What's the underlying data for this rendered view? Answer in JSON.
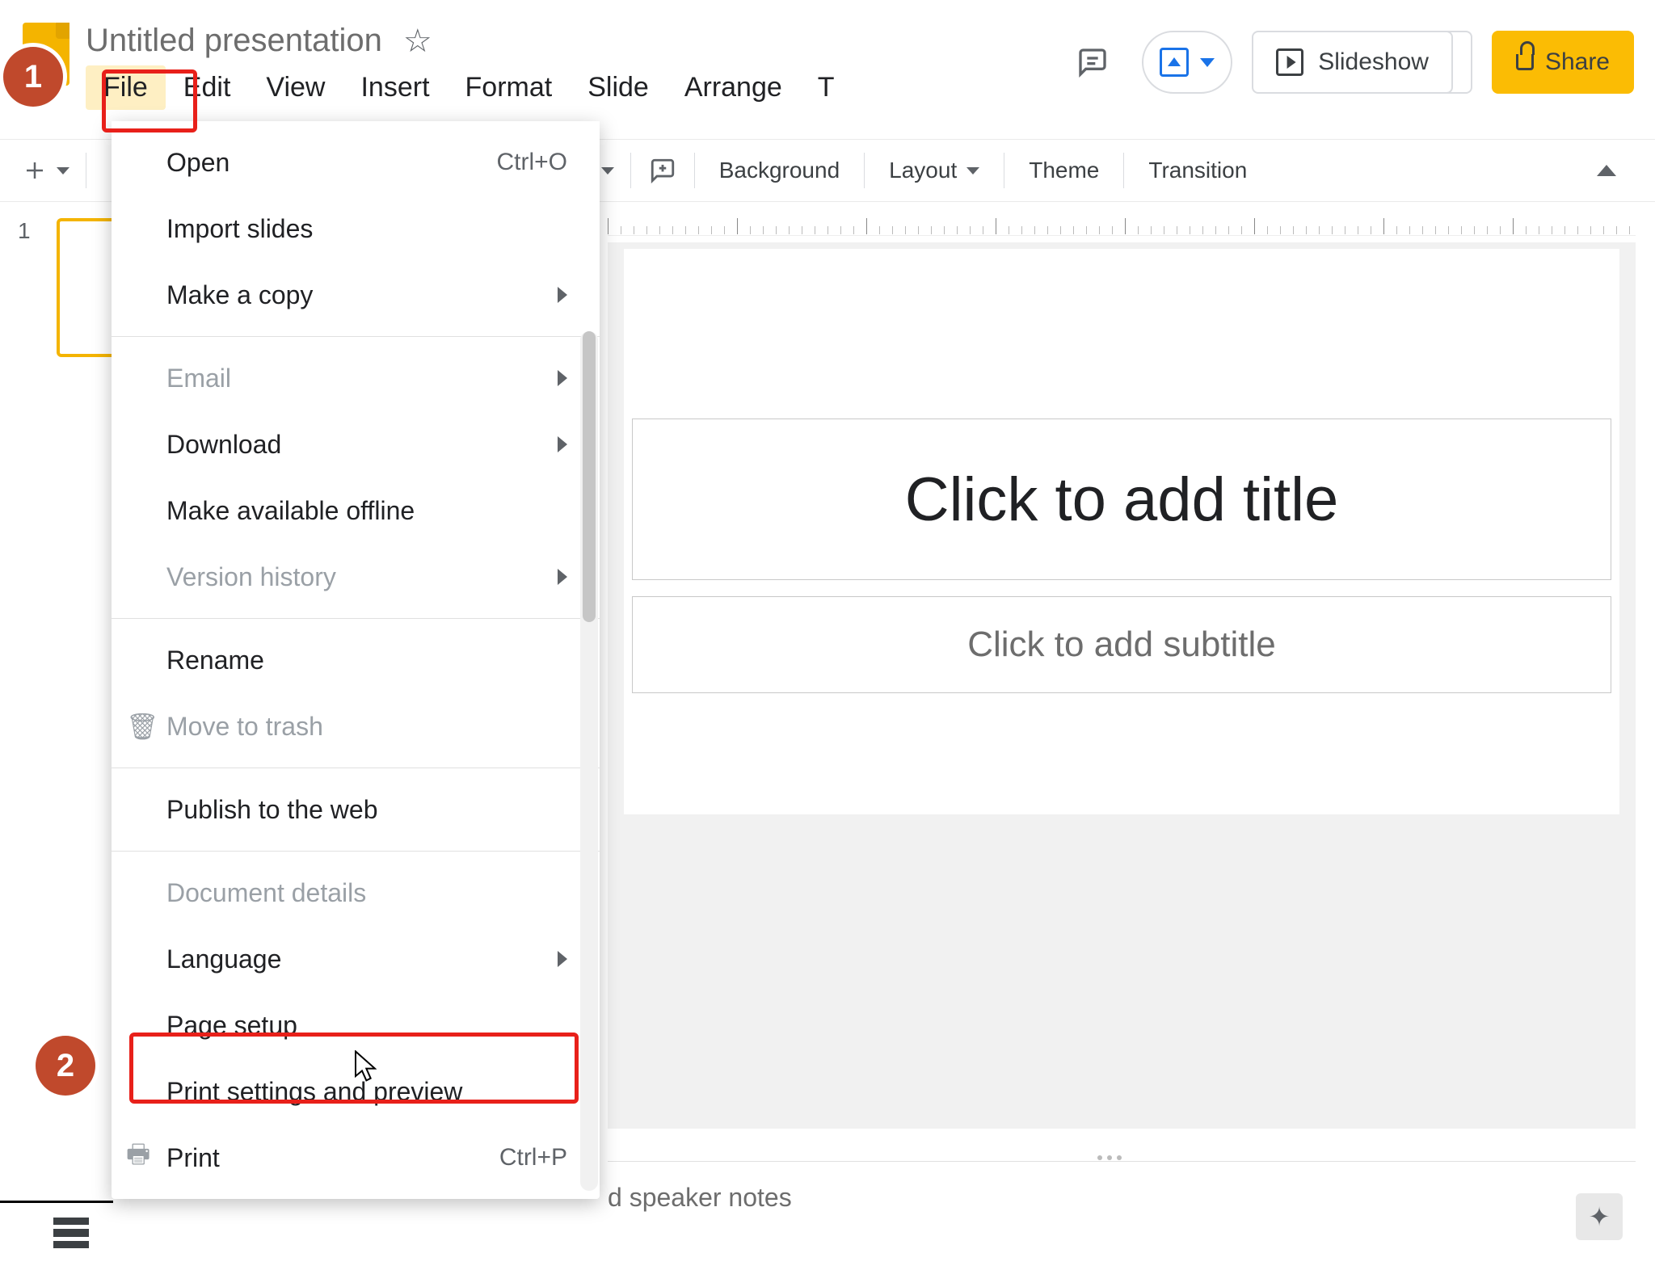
{
  "header": {
    "doc_title": "Untitled presentation"
  },
  "menubar": {
    "file": "File",
    "edit": "Edit",
    "view": "View",
    "insert": "Insert",
    "format": "Format",
    "slide": "Slide",
    "arrange": "Arrange",
    "tools_cut": "T"
  },
  "actions": {
    "slideshow": "Slideshow",
    "share": "Share"
  },
  "toolbar": {
    "background": "Background",
    "layout": "Layout",
    "theme": "Theme",
    "transition": "Transition"
  },
  "thumbs": {
    "first_index": "1"
  },
  "canvas": {
    "title_placeholder": "Click to add title",
    "subtitle_placeholder": "Click to add subtitle"
  },
  "notes": {
    "placeholder_fragment": "d speaker notes"
  },
  "file_menu": {
    "open": {
      "label": "Open",
      "shortcut": "Ctrl+O"
    },
    "import_slides": "Import slides",
    "make_copy": "Make a copy",
    "email": "Email",
    "download": "Download",
    "make_offline": "Make available offline",
    "version_history": "Version history",
    "rename": "Rename",
    "move_to_trash": "Move to trash",
    "publish": "Publish to the web",
    "doc_details": "Document details",
    "language": "Language",
    "page_setup": "Page setup",
    "print_settings": "Print settings and preview",
    "print": {
      "label": "Print",
      "shortcut": "Ctrl+P"
    }
  },
  "annotations": {
    "step1": "1",
    "step2": "2"
  }
}
